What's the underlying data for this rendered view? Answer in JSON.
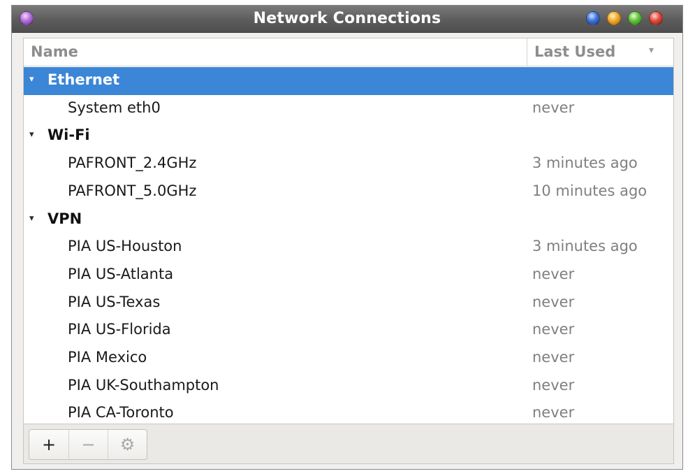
{
  "window": {
    "title": "Network Connections"
  },
  "titlebar_icons": [
    "menu-orb-icon",
    "minimize-icon",
    "shade-icon",
    "maximize-icon",
    "close-icon"
  ],
  "columns": {
    "name": "Name",
    "last_used": "Last Used",
    "sort_glyph": "▾"
  },
  "groups": [
    {
      "label": "Ethernet",
      "expander": "▾",
      "selected": true,
      "items": [
        {
          "name": "System eth0",
          "last_used": "never"
        }
      ]
    },
    {
      "label": "Wi-Fi",
      "expander": "▾",
      "selected": false,
      "items": [
        {
          "name": "PAFRONT_2.4GHz",
          "last_used": "3 minutes ago"
        },
        {
          "name": "PAFRONT_5.0GHz",
          "last_used": "10 minutes ago"
        }
      ]
    },
    {
      "label": "VPN",
      "expander": "▾",
      "selected": false,
      "items": [
        {
          "name": "PIA US-Houston",
          "last_used": "3 minutes ago"
        },
        {
          "name": "PIA US-Atlanta",
          "last_used": "never"
        },
        {
          "name": "PIA US-Texas",
          "last_used": "never"
        },
        {
          "name": "PIA US-Florida",
          "last_used": "never"
        },
        {
          "name": "PIA Mexico",
          "last_used": "never"
        },
        {
          "name": "PIA UK-Southampton",
          "last_used": "never"
        },
        {
          "name": "PIA CA-Toronto",
          "last_used": "never"
        }
      ]
    }
  ],
  "toolbar": {
    "add_label": "+",
    "remove_label": "−",
    "settings_label": "⚙"
  },
  "colors": {
    "selection": "#3b86d6",
    "muted_text": "#7f7f7f"
  }
}
